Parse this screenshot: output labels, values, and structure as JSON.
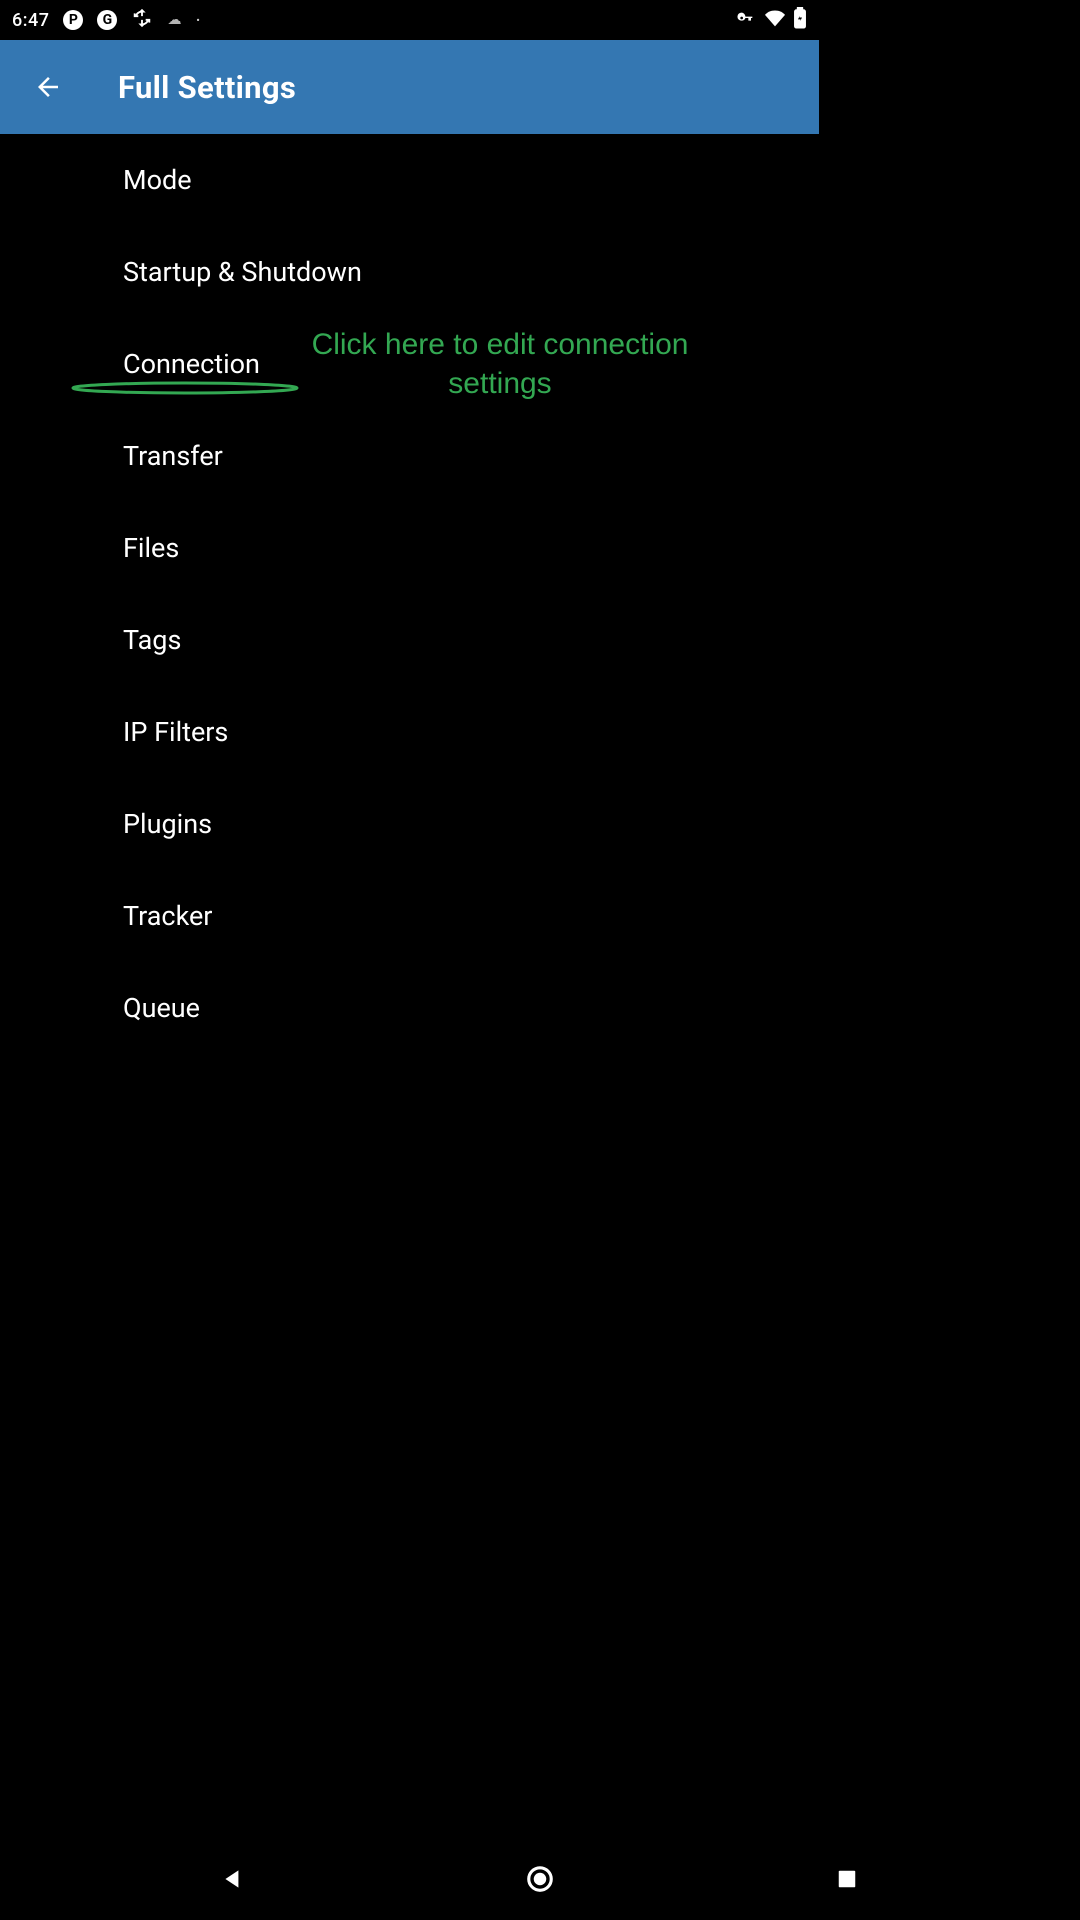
{
  "status": {
    "time": "6:47",
    "iconP": "P",
    "iconG": "G"
  },
  "appbar": {
    "title": "Full Settings"
  },
  "items": [
    {
      "label": "Mode"
    },
    {
      "label": "Startup & Shutdown"
    },
    {
      "label": "Connection"
    },
    {
      "label": "Transfer"
    },
    {
      "label": "Files"
    },
    {
      "label": "Tags"
    },
    {
      "label": "IP Filters"
    },
    {
      "label": "Plugins"
    },
    {
      "label": "Tracker"
    },
    {
      "label": "Queue"
    }
  ],
  "hint": "Click here to edit connection settings",
  "accent": "#33a852",
  "toolbarColor": "#3477b2"
}
